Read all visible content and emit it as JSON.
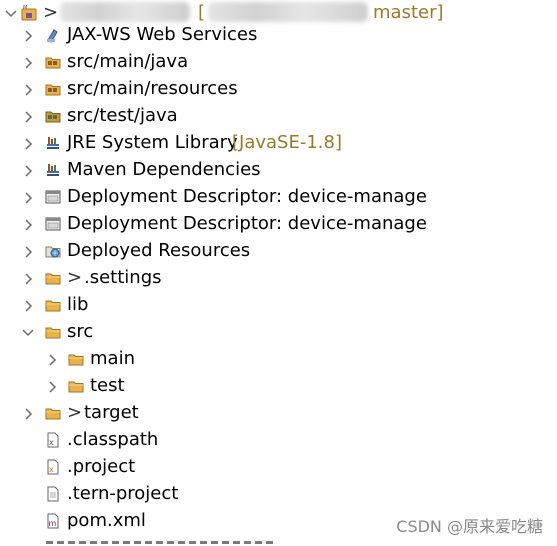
{
  "project_root": {
    "decoration_prefix": ">",
    "branch_suffix": "master]"
  },
  "items": [
    {
      "label": "JAX-WS Web Services",
      "icon": "web-services-icon"
    },
    {
      "label": "src/main/java",
      "icon": "source-folder-icon"
    },
    {
      "label": "src/main/resources",
      "icon": "source-folder-icon"
    },
    {
      "label": "src/test/java",
      "icon": "test-source-folder-icon"
    },
    {
      "label": "JRE System Library",
      "decoration": "[JavaSE-1.8]",
      "icon": "library-icon"
    },
    {
      "label": "Maven Dependencies",
      "icon": "library-icon"
    },
    {
      "label": "Deployment Descriptor: device-manage",
      "icon": "deployment-descriptor-icon"
    },
    {
      "label": "Deployment Descriptor: device-manage",
      "icon": "deployment-descriptor-icon"
    },
    {
      "label": "Deployed Resources",
      "icon": "deployed-resources-icon"
    },
    {
      "prefix": ">",
      "label": ".settings",
      "icon": "folder-icon"
    },
    {
      "label": "lib",
      "icon": "folder-icon"
    },
    {
      "label": "src",
      "icon": "folder-icon"
    },
    {
      "label": "main",
      "icon": "folder-icon"
    },
    {
      "label": "test",
      "icon": "folder-icon"
    },
    {
      "prefix": ">",
      "label": "target",
      "icon": "folder-icon"
    },
    {
      "label": ".classpath",
      "icon": "xml-file-icon"
    },
    {
      "label": ".project",
      "icon": "xml-file-icon"
    },
    {
      "label": ".tern-project",
      "icon": "text-file-icon"
    },
    {
      "label": "pom.xml",
      "icon": "xml-file-icon"
    }
  ],
  "watermark": "CSDN @原来爱吃糖",
  "colors": {
    "decoration": "#9a7a2a",
    "twisty": "#6b6b6b",
    "folder": "#e8b34a"
  }
}
